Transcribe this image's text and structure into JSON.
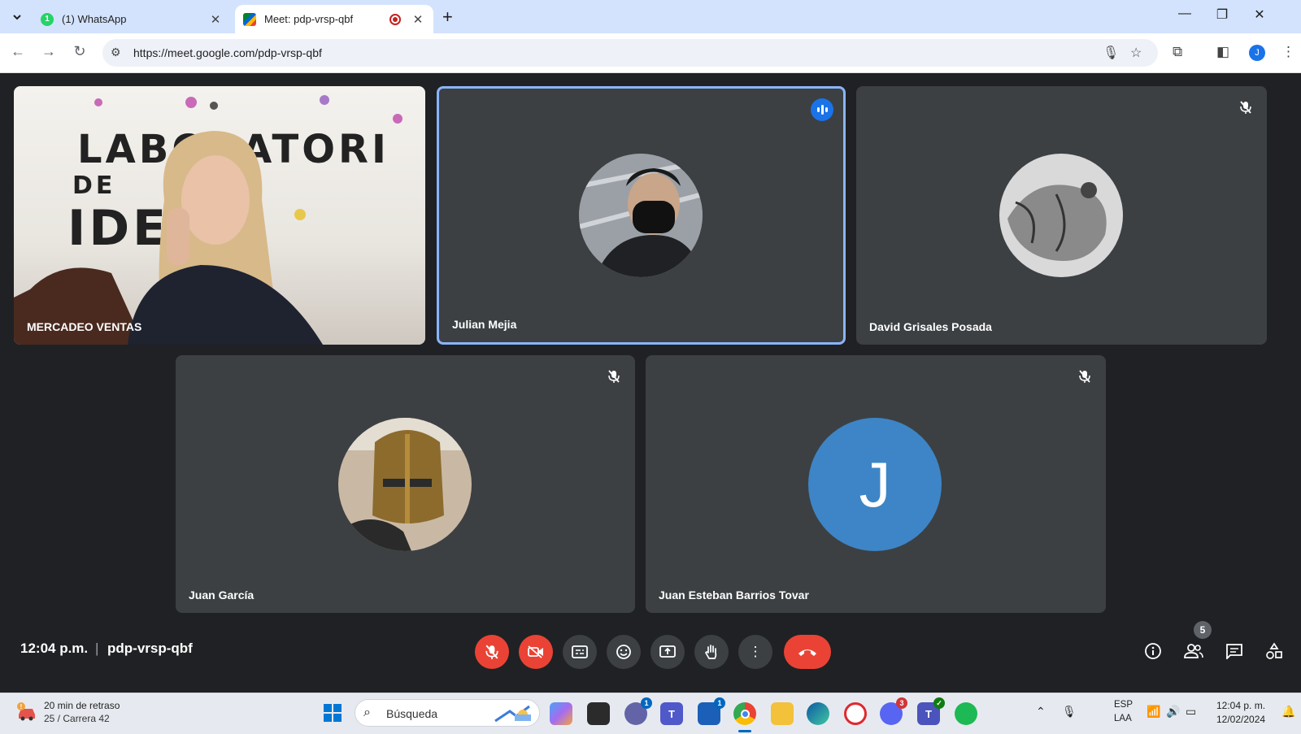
{
  "browser": {
    "tabs": [
      {
        "title": "(1) WhatsApp",
        "favicon": "whatsapp-icon",
        "badge": "1"
      },
      {
        "title": "Meet: pdp-vrsp-qbf",
        "favicon": "google-meet-icon",
        "recording": true
      }
    ],
    "url": "https://meet.google.com/pdp-vrsp-qbf",
    "profile_initial": "J"
  },
  "participants": [
    {
      "name": "MERCADEO VENTAS",
      "video": true,
      "bg_text": [
        "LABORATORI",
        "DE",
        "IDE"
      ]
    },
    {
      "name": "Julian Mejia",
      "speaking": true
    },
    {
      "name": "David Grisales Posada",
      "muted": true
    },
    {
      "name": "Juan García",
      "muted": true
    },
    {
      "name": "Juan Esteban Barrios Tovar",
      "muted": true,
      "initial": "J",
      "avatar_color": "#3d85c6"
    }
  ],
  "meeting": {
    "time": "12:04 p.m.",
    "code": "pdp-vrsp-qbf",
    "participant_count": "5"
  },
  "taskbar": {
    "weather_line1": "20 min de retraso",
    "weather_line2": "25 / Carrera 42",
    "search_placeholder": "Búsqueda",
    "badges": {
      "chat": "1",
      "store": "1",
      "discord": "3"
    },
    "lang_line1": "ESP",
    "lang_line2": "LAA",
    "clock_time": "12:04 p. m.",
    "clock_date": "12/02/2024"
  },
  "colors": {
    "meet_bg": "#202124",
    "tile_bg": "#3c4043",
    "danger_red": "#ea4335",
    "active_blue": "#1a73e8",
    "tab_strip": "#d3e3fd"
  }
}
